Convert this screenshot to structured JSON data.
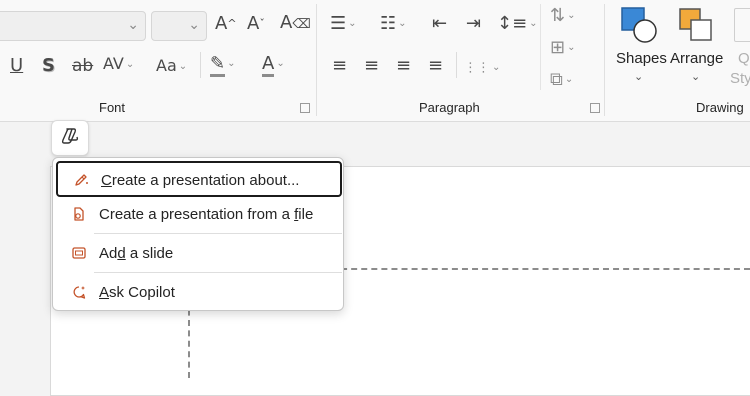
{
  "ribbon": {
    "groups": {
      "font": "Font",
      "paragraph": "Paragraph",
      "drawing": "Drawing"
    },
    "buttons": {
      "grow_font": "A^",
      "shrink_font": "A˅",
      "underline": "U",
      "shadow": "S",
      "strikethrough": "ab",
      "char_spacing": "AV",
      "change_case": "Aa",
      "font_color": "A",
      "align_text": "≡≡"
    },
    "drawing": {
      "shapes": "Shapes",
      "arrange": "Arrange",
      "quick_styles_top": "Q",
      "quick_styles_bottom": "Sty"
    }
  },
  "copilot_menu": {
    "items": [
      {
        "prefix": "",
        "accel": "C",
        "suffix": "reate a presentation about..."
      },
      {
        "prefix": "Create a presentation from a ",
        "accel": "f",
        "suffix": "ile"
      },
      {
        "prefix": "Ad",
        "accel": "d",
        "suffix": " a slide"
      },
      {
        "prefix": "",
        "accel": "A",
        "suffix": "sk Copilot"
      }
    ]
  },
  "colors": {
    "accent_orange": "#c4532a",
    "shapes_blue": "#3a88d6",
    "arrange_orange": "#f2a93b"
  }
}
